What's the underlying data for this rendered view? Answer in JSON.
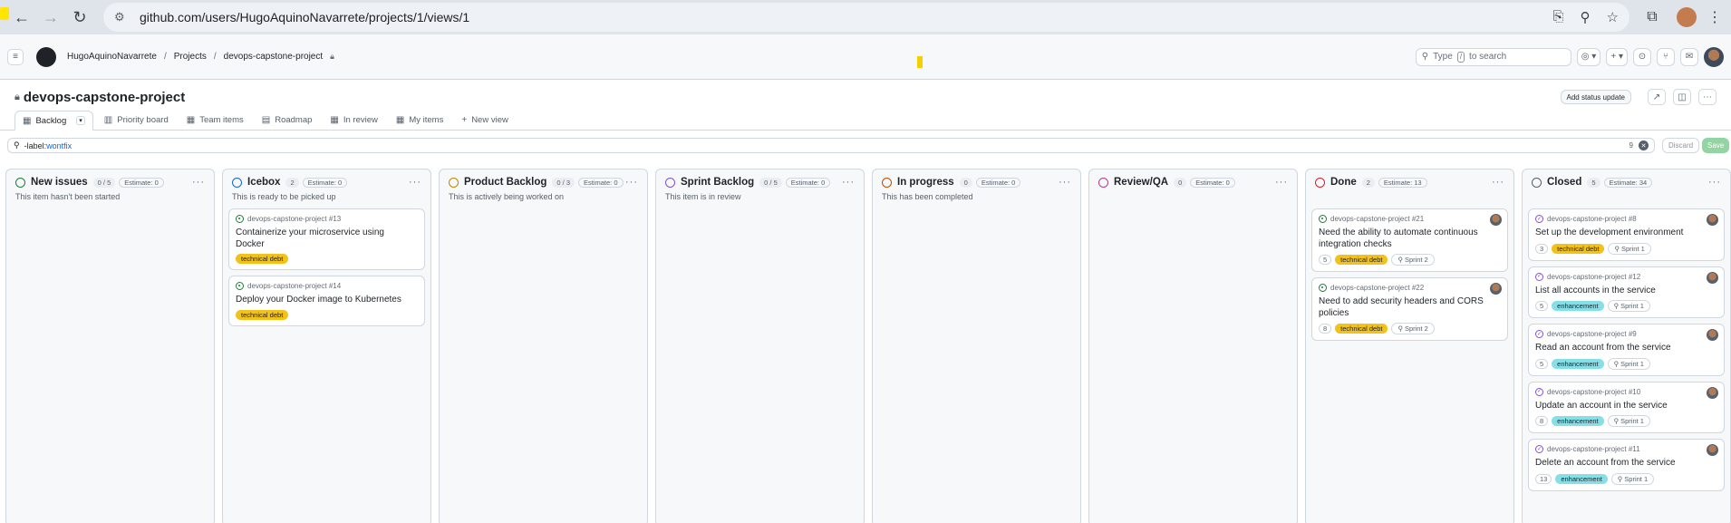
{
  "browser": {
    "url": "github.com/users/HugoAquinoNavarrete/projects/1/views/1"
  },
  "header": {
    "crumbs": [
      "HugoAquinoNavarrete",
      "Projects",
      "devops-capstone-project"
    ],
    "search_placeholder": "Type",
    "search_kbd": "/",
    "search_suffix": "to search",
    "new_label": "+"
  },
  "project": {
    "title": "devops-capstone-project",
    "status_button": "Add status update"
  },
  "views": [
    {
      "label": "Backlog",
      "icon": "table-icon"
    },
    {
      "label": "Priority board",
      "icon": "board-icon"
    },
    {
      "label": "Team items",
      "icon": "table-icon"
    },
    {
      "label": "Roadmap",
      "icon": "roadmap-icon"
    },
    {
      "label": "In review",
      "icon": "table-icon"
    },
    {
      "label": "My items",
      "icon": "table-icon"
    }
  ],
  "new_view_label": "New view",
  "filter": {
    "prefix": "-label:",
    "value": "wontfix",
    "count": "9",
    "discard": "Discard",
    "save": "Save"
  },
  "columns": [
    {
      "name": "New issues",
      "count": "0 / 5",
      "estimate": "Estimate: 0",
      "desc": "This item hasn't been started",
      "color": "#1a7f37",
      "cards": []
    },
    {
      "name": "Icebox",
      "count": "2",
      "estimate": "Estimate: 0",
      "desc": "This is ready to be picked up",
      "color": "#0969da",
      "cards": [
        {
          "ref": "devops-capstone-project #13",
          "title": "Containerize your microservice using Docker",
          "state": "open",
          "labels": [
            "technical debt"
          ]
        },
        {
          "ref": "devops-capstone-project #14",
          "title": "Deploy your Docker image to Kubernetes",
          "state": "open",
          "labels": [
            "technical debt"
          ]
        }
      ]
    },
    {
      "name": "Product Backlog",
      "count": "0 / 3",
      "estimate": "Estimate: 0",
      "desc": "This is actively being worked on",
      "color": "#bf8700",
      "cards": []
    },
    {
      "name": "Sprint Backlog",
      "count": "0 / 5",
      "estimate": "Estimate: 0",
      "desc": "This item is in review",
      "color": "#8250df",
      "cards": []
    },
    {
      "name": "In progress",
      "count": "0",
      "estimate": "Estimate: 0",
      "desc": "This has been completed",
      "color": "#bc4c00",
      "cards": []
    },
    {
      "name": "Review/QA",
      "count": "0",
      "estimate": "Estimate: 0",
      "desc": "",
      "color": "#bf3989",
      "cards": []
    },
    {
      "name": "Done",
      "count": "2",
      "estimate": "Estimate: 13",
      "desc": "",
      "color": "#cf222e",
      "cards": [
        {
          "ref": "devops-capstone-project #21",
          "title": "Need the ability to automate continuous integration checks",
          "state": "open",
          "points": "5",
          "labels": [
            "technical debt"
          ],
          "sprint": "Sprint 2"
        },
        {
          "ref": "devops-capstone-project #22",
          "title": "Need to add security headers and CORS policies",
          "state": "open",
          "points": "8",
          "labels": [
            "technical debt"
          ],
          "sprint": "Sprint 2"
        }
      ]
    },
    {
      "name": "Closed",
      "count": "5",
      "estimate": "Estimate: 34",
      "desc": "",
      "color": "#57606a",
      "cards": [
        {
          "ref": "devops-capstone-project #8",
          "title": "Set up the development environment",
          "state": "closed",
          "points": "3",
          "labels": [
            "technical debt"
          ],
          "sprint": "Sprint 1"
        },
        {
          "ref": "devops-capstone-project #12",
          "title": "List all accounts in the service",
          "state": "closed",
          "points": "5",
          "labels": [
            "enhancement"
          ],
          "sprint": "Sprint 1"
        },
        {
          "ref": "devops-capstone-project #9",
          "title": "Read an account from the service",
          "state": "closed",
          "points": "5",
          "labels": [
            "enhancement"
          ],
          "sprint": "Sprint 1"
        },
        {
          "ref": "devops-capstone-project #10",
          "title": "Update an account in the service",
          "state": "closed",
          "points": "8",
          "labels": [
            "enhancement"
          ],
          "sprint": "Sprint 1"
        },
        {
          "ref": "devops-capstone-project #11",
          "title": "Delete an account from the service",
          "state": "closed",
          "points": "13",
          "labels": [
            "enhancement"
          ],
          "sprint": "Sprint 1"
        }
      ]
    }
  ]
}
